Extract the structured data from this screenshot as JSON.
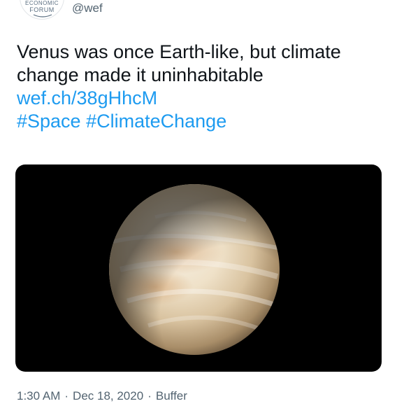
{
  "author": {
    "avatar_text_top": "ECONOMIC",
    "avatar_text": "FORUM",
    "handle": "@wef"
  },
  "tweet": {
    "text_plain": "Venus was once Earth-like, but climate change made it uninhabitable",
    "link": "wef.ch/38gHhcM",
    "hashtags": [
      "#Space",
      "#ClimateChange"
    ],
    "media_icon": "venus-planet-image"
  },
  "meta": {
    "time": "1:30 AM",
    "date": "Dec 18, 2020",
    "source": "Buffer",
    "separator": "·"
  },
  "colors": {
    "link": "#1d9bf0",
    "text": "#0f1419",
    "muted": "#536471",
    "media_bg": "#000000"
  }
}
